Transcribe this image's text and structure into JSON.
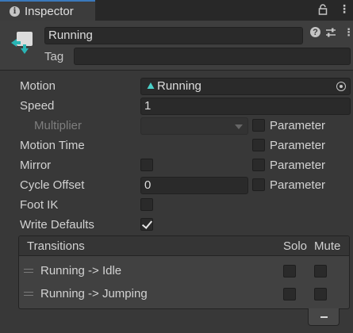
{
  "tab": {
    "title": "Inspector",
    "info_icon": "info-icon",
    "lock_icon": "lock-icon",
    "menu_icon": "kebab-menu-icon"
  },
  "header": {
    "state_icon": "animator-state-icon",
    "name": "Running",
    "tag_label": "Tag",
    "tag_value": "",
    "help_icon": "help-icon",
    "preset_icon": "preset-sliders-icon",
    "menu_icon": "kebab-menu-icon"
  },
  "properties": {
    "motion": {
      "label": "Motion",
      "value": "Running",
      "icon": "blend-tree-triangle-icon"
    },
    "speed": {
      "label": "Speed",
      "value": "1"
    },
    "multiplier": {
      "label": "Multiplier",
      "value": "",
      "param_label": "Parameter",
      "param_checked": false
    },
    "motion_time": {
      "label": "Motion Time",
      "param_label": "Parameter",
      "param_checked": false
    },
    "mirror": {
      "label": "Mirror",
      "checked": false,
      "param_label": "Parameter",
      "param_checked": false
    },
    "cycle_offset": {
      "label": "Cycle Offset",
      "value": "0",
      "param_label": "Parameter",
      "param_checked": false
    },
    "foot_ik": {
      "label": "Foot IK",
      "checked": false
    },
    "write_defaults": {
      "label": "Write Defaults",
      "checked": true
    }
  },
  "transitions": {
    "title": "Transitions",
    "solo_label": "Solo",
    "mute_label": "Mute",
    "rows": [
      {
        "label": "Running -> Idle",
        "solo": false,
        "mute": false
      },
      {
        "label": "Running -> Jumping",
        "solo": false,
        "mute": false
      }
    ],
    "remove_icon": "minus-icon"
  },
  "colors": {
    "background": "#383838",
    "field": "#2a2a2a",
    "tab_accent": "#3a79bb",
    "state_icon_accent": "#2ab5b5"
  }
}
